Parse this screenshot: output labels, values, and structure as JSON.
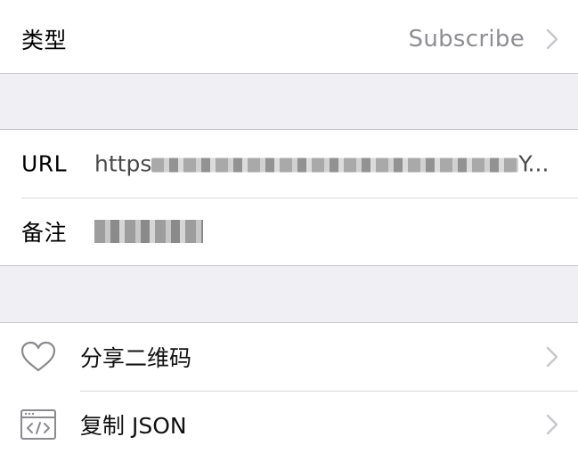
{
  "type_row": {
    "label": "类型",
    "value": "Subscribe"
  },
  "url_row": {
    "label": "URL",
    "value_prefix": "https",
    "value_suffix": "Y..."
  },
  "note_row": {
    "label": "备注"
  },
  "actions": [
    {
      "label": "分享二维码",
      "icon": "heart-icon"
    },
    {
      "label": "复制 JSON",
      "icon": "code-window-icon"
    }
  ],
  "colors": {
    "background": "#efeff4",
    "cell": "#ffffff",
    "secondary_text": "#8e8e93",
    "chevron": "#c7c7cc",
    "separator": "#c8c7cc"
  }
}
